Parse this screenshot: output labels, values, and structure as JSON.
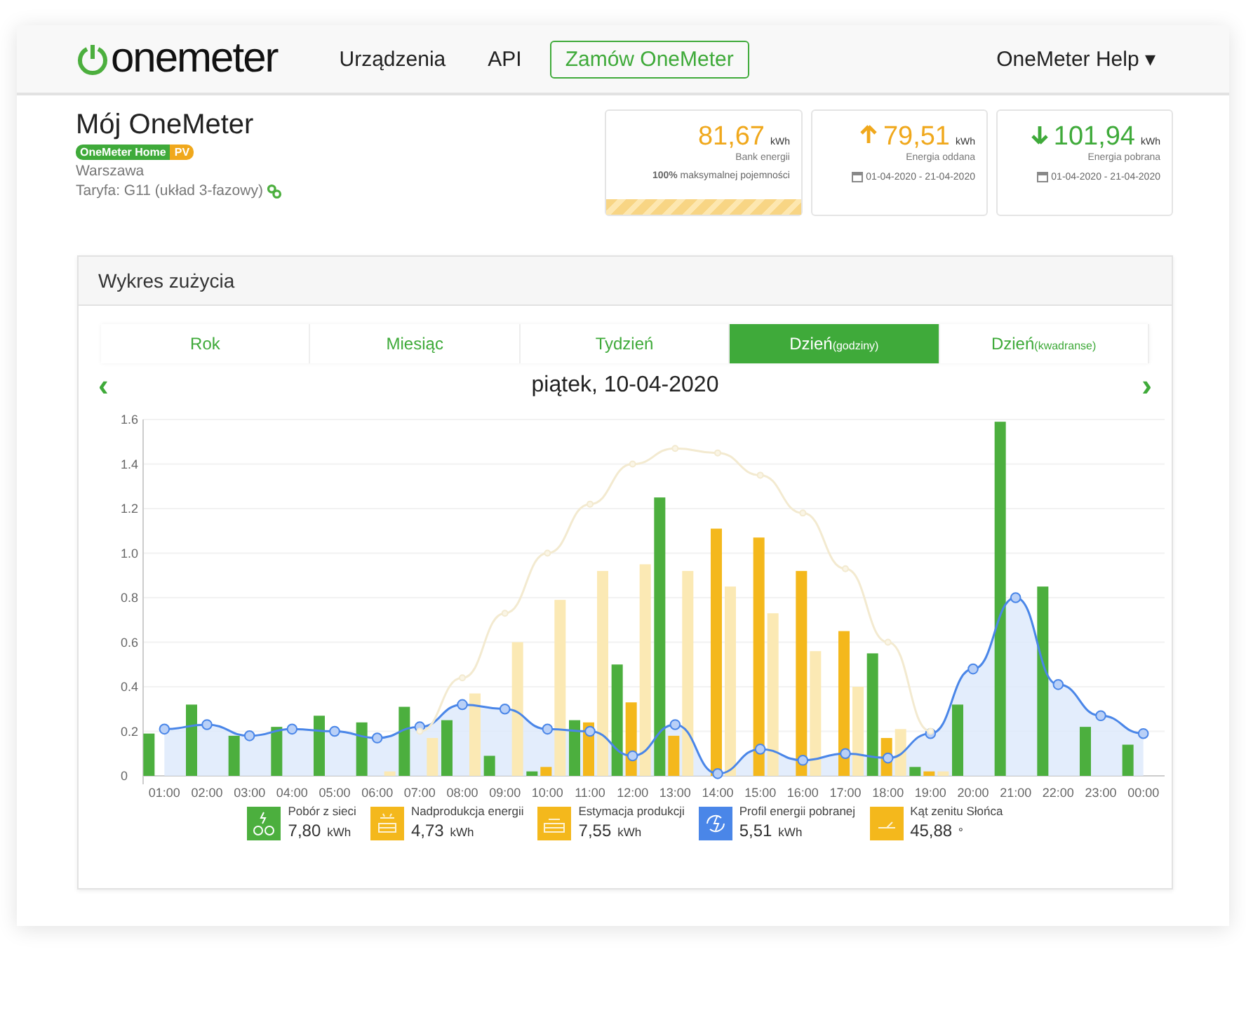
{
  "nav": {
    "logo": "onemeter",
    "links": [
      {
        "label": "Urządzenia",
        "kind": "link"
      },
      {
        "label": "API",
        "kind": "link"
      },
      {
        "label": "Zamów OneMeter",
        "kind": "outline"
      }
    ],
    "help": "OneMeter Help ▾"
  },
  "header": {
    "title": "Mój OneMeter",
    "badges": [
      {
        "label": "OneMeter Home",
        "color": "#3faa3a"
      },
      {
        "label": "PV",
        "color": "#f0a81c"
      }
    ],
    "city": "Warszawa",
    "tariff": "Taryfa: G11 (układ 3-fazowy)"
  },
  "stats": [
    {
      "kind": "bank",
      "value": "81,67",
      "unit": "kWh",
      "label": "Bank energii",
      "note": "**100%** maksymalnej pojemności",
      "level": 1
    },
    {
      "kind": "up",
      "value": "79,51",
      "unit": "kWh",
      "label": "Energia oddana",
      "note": "01-04-2020 - 21-04-2020"
    },
    {
      "kind": "down",
      "value": "101,94",
      "unit": "kWh",
      "label": "Energia pobrana",
      "note": "01-04-2020 - 21-04-2020"
    }
  ],
  "panel": {
    "title": "Wykres zużycia",
    "tabs": [
      {
        "label": "Rok",
        "selected": false
      },
      {
        "label": "Miesiąc",
        "selected": false
      },
      {
        "label": "Tydzień",
        "selected": false
      },
      {
        "label": "Dzień",
        "sub": "(godziny)",
        "selected": true
      },
      {
        "label": "Dzień",
        "sub": "(kwadranse)",
        "selected": false
      }
    ],
    "prev": "‹",
    "next": "›",
    "date": "piątek, 10-04-2020",
    "chart_data": {
      "type": "bar",
      "categories": [
        "01:00",
        "02:00",
        "03:00",
        "04:00",
        "05:00",
        "06:00",
        "07:00",
        "08:00",
        "09:00",
        "10:00",
        "11:00",
        "12:00",
        "13:00",
        "14:00",
        "15:00",
        "16:00",
        "17:00",
        "18:00",
        "19:00",
        "20:00",
        "21:00",
        "22:00",
        "23:00",
        "00:00"
      ],
      "yticks": [
        {
          "value": 0,
          "label": "0"
        },
        0.2,
        0.4,
        0.6,
        0.8,
        {
          "value": 1,
          "label": "1.0"
        },
        1.2,
        1.4,
        1.6
      ],
      "ylim": [
        0,
        1.6
      ],
      "grid": true,
      "series": [
        {
          "name": "Pobór z sieci",
          "color": "#4caf3e",
          "type": "bar",
          "values": [
            0.19,
            0.32,
            0.18,
            0.22,
            0.27,
            0.24,
            0.31,
            0.25,
            0.09,
            0.02,
            0.25,
            0.5,
            1.25,
            0,
            0,
            0,
            0,
            0.55,
            0.04,
            0.32,
            1.59,
            0.85,
            0.22,
            0.14
          ]
        },
        {
          "name": "Nadprodukcja energii",
          "color": "#f4b81c",
          "type": "bar",
          "values": [
            0,
            0,
            0,
            0,
            0,
            0,
            0,
            0,
            0,
            0.04,
            0.24,
            0.33,
            0.18,
            1.11,
            1.07,
            0.92,
            0.65,
            0.17,
            0.02,
            0,
            0,
            0,
            0,
            0
          ]
        },
        {
          "name": "Estymacja produkcji",
          "color": "#fbe9b4",
          "type": "bar",
          "values": [
            0,
            0,
            0,
            0,
            0,
            0.02,
            0.17,
            0.37,
            0.6,
            0.79,
            0.92,
            0.95,
            0.92,
            0.85,
            0.73,
            0.56,
            0.4,
            0.21,
            0.02,
            0,
            0,
            0,
            0,
            0
          ]
        },
        {
          "name": "Profil energii pobranej",
          "color": "#4a86e8",
          "type": "area",
          "marker": "circle",
          "values": [
            0.21,
            0.23,
            0.18,
            0.21,
            0.2,
            0.17,
            0.22,
            0.32,
            0.3,
            0.21,
            0.2,
            0.09,
            0.23,
            0.01,
            0.12,
            0.07,
            0.1,
            0.08,
            0.19,
            0.48,
            0.8,
            0.41,
            0.27,
            0.19
          ]
        },
        {
          "name": "Kąt zenitu Słońca",
          "color": "#f3ead0",
          "type": "line",
          "marker": "circle",
          "values": [
            null,
            null,
            null,
            null,
            null,
            null,
            0.2,
            0.44,
            0.73,
            1.0,
            1.22,
            1.4,
            1.47,
            1.45,
            1.35,
            1.18,
            0.93,
            0.6,
            0.2,
            null,
            null,
            null,
            null,
            null
          ]
        }
      ]
    },
    "legend": [
      {
        "kind": "plug",
        "value": "7,80",
        "unit": "kWh",
        "color": "#4caf3e"
      },
      {
        "kind": "sunhouse",
        "value": "4,73",
        "unit": "kWh",
        "color": "#f4b81c"
      },
      {
        "kind": "house",
        "value": "7,55",
        "unit": "kWh",
        "color": "#f4b81c"
      },
      {
        "kind": "cycle",
        "value": "5,51",
        "unit": "kWh",
        "color": "#4a86e8"
      },
      {
        "kind": "angle",
        "value": "45,88",
        "unit": "°",
        "color": "#f4b81c"
      }
    ]
  }
}
